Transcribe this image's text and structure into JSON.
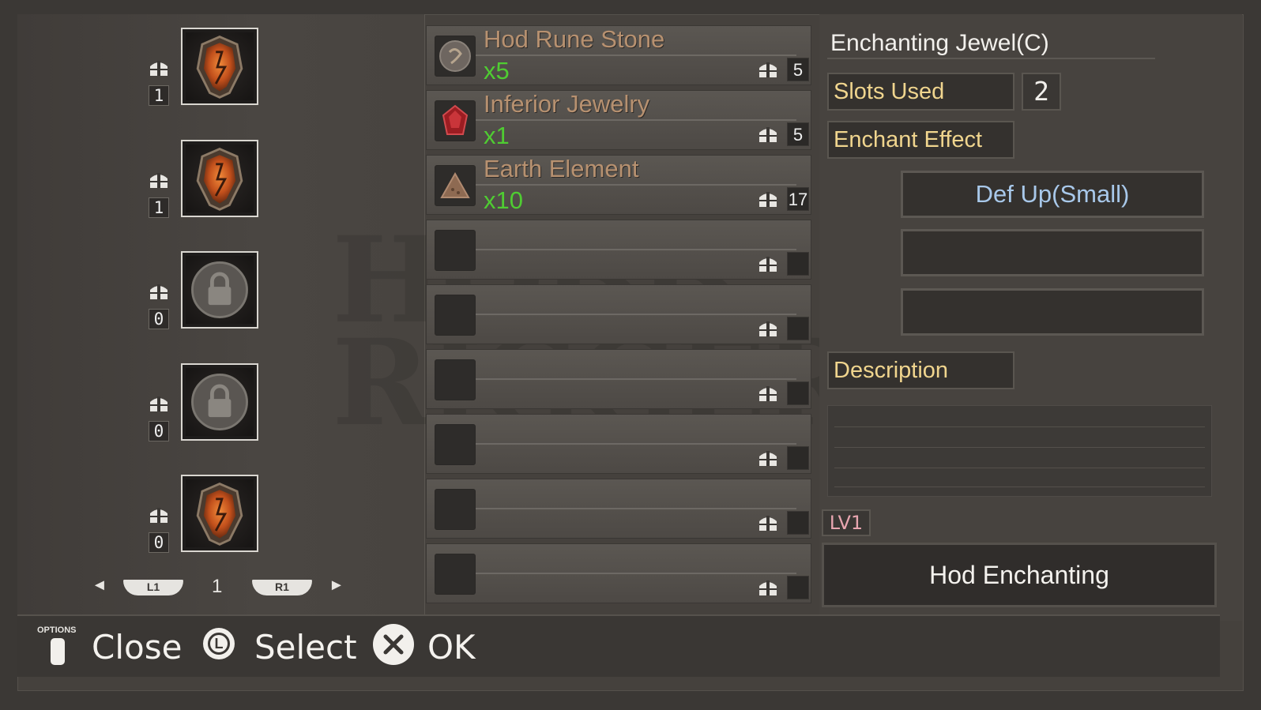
{
  "jewel_slots": [
    {
      "count": "1",
      "type": "rune",
      "locked": false
    },
    {
      "count": "1",
      "type": "rune",
      "locked": false
    },
    {
      "count": "0",
      "type": "locked",
      "locked": true
    },
    {
      "count": "0",
      "type": "locked",
      "locked": true
    },
    {
      "count": "0",
      "type": "rune",
      "locked": false
    }
  ],
  "pager": {
    "prev_arrow": "◄",
    "l1": "L1",
    "page": "1",
    "r1": "R1",
    "next_arrow": "►"
  },
  "materials": [
    {
      "name": "Hod Rune Stone",
      "qty": "x5",
      "stock": "5",
      "icon": "rune-stone-icon"
    },
    {
      "name": "Inferior Jewelry",
      "qty": "x1",
      "stock": "5",
      "icon": "red-gem-icon"
    },
    {
      "name": "Earth Element",
      "qty": "x10",
      "stock": "17",
      "icon": "earth-element-icon"
    },
    {
      "name": "",
      "qty": "",
      "stock": ""
    },
    {
      "name": "",
      "qty": "",
      "stock": ""
    },
    {
      "name": "",
      "qty": "",
      "stock": ""
    },
    {
      "name": "",
      "qty": "",
      "stock": ""
    },
    {
      "name": "",
      "qty": "",
      "stock": ""
    },
    {
      "name": "",
      "qty": "",
      "stock": ""
    }
  ],
  "details": {
    "title": "Enchanting Jewel(C)",
    "slots_used_label": "Slots Used",
    "slots_used_value": "2",
    "enchant_effect_label": "Enchant Effect",
    "effects": [
      "Def Up(Small)",
      "",
      ""
    ],
    "description_label": "Description",
    "description": "",
    "level": "LV1",
    "action_button": "Hod Enchanting"
  },
  "footer": {
    "options_caption": "OPTIONS",
    "close": "Close",
    "select_button": "L",
    "select": "Select",
    "ok": "OK"
  },
  "watermark": "HOBB RIGGER",
  "colors": {
    "material_name": "#b79170",
    "quantity": "#4fcc32",
    "label": "#f0d58e",
    "effect": "#a8c8ea",
    "level": "#e8a6b0"
  }
}
